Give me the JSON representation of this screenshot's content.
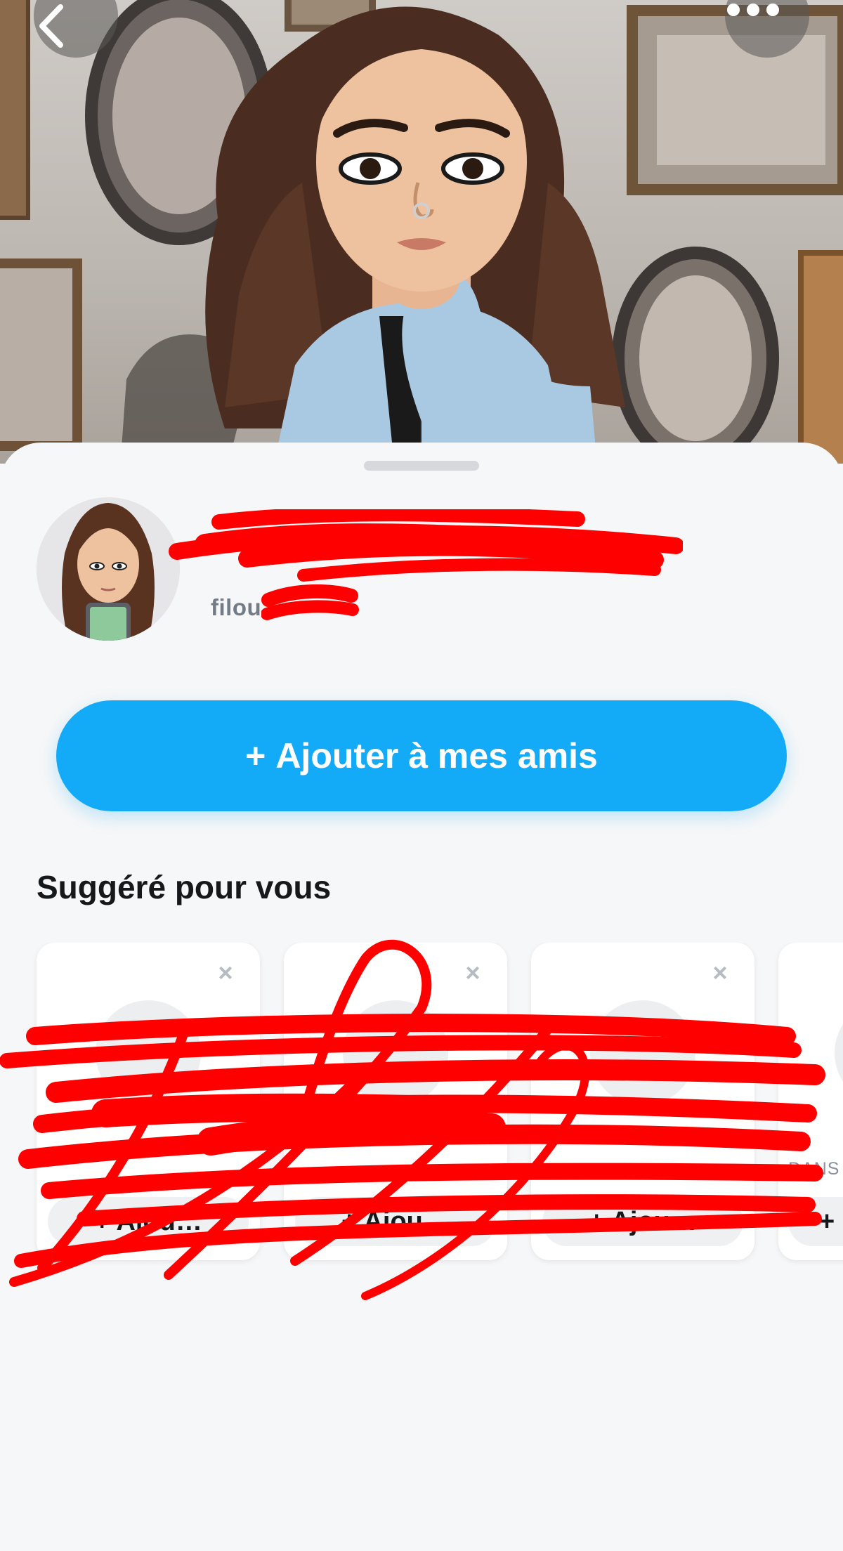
{
  "header": {
    "back_icon": "chevron-left-icon",
    "more_icon": "ellipsis-icon"
  },
  "profile": {
    "display_name": "",
    "username": "filou",
    "username_redacted": true,
    "display_name_redacted": true
  },
  "actions": {
    "add_friend_plus": "+",
    "add_friend_label": "Ajouter à mes amis"
  },
  "suggestions": {
    "title": "Suggéré pour vous",
    "cards": [
      {
        "dismiss": "×",
        "subtitle": "",
        "button": "+ Ajou…"
      },
      {
        "dismiss": "×",
        "subtitle": "",
        "button": "+ Ajou…"
      },
      {
        "dismiss": "×",
        "subtitle": "",
        "button": "+ Ajou…"
      },
      {
        "dismiss": "",
        "subtitle": "DANS",
        "button": "+"
      }
    ]
  },
  "colors": {
    "accent": "#13abf7",
    "sheet_bg": "#f6f7f8",
    "redaction": "#ff0000"
  }
}
